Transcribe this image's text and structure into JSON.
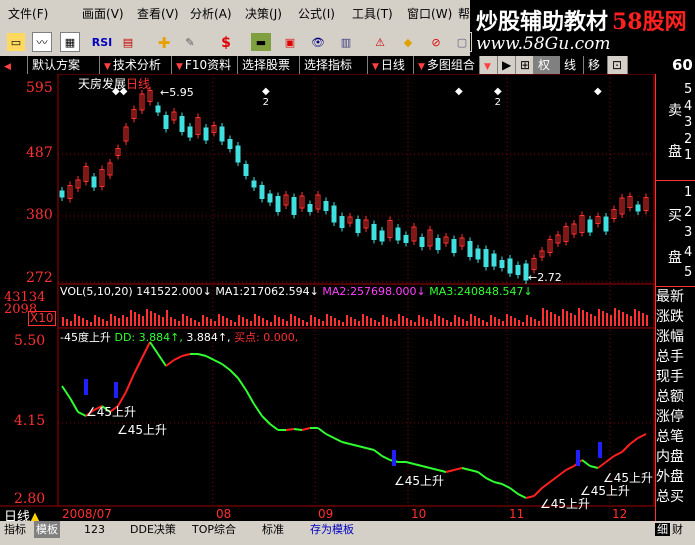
{
  "menu": {
    "items": [
      "文件",
      "画面",
      "查看",
      "分析",
      "决策",
      "公式",
      "工具",
      "窗口",
      "帮"
    ],
    "shortcuts": [
      "(F)",
      "(V)",
      "(V)",
      "(A)",
      "(J)",
      "(I)",
      "(T)",
      "(W)"
    ]
  },
  "logo": {
    "text": "炒股辅助教材",
    "brand": "58股网",
    "url": "www.58Gu.com"
  },
  "toolbar": {
    "rsi_label": "RSI",
    "dollar_label": "$"
  },
  "tabs": {
    "items": [
      "默认方案",
      "技术分析",
      "F10资料",
      "选择股票",
      "选择指标",
      "日线",
      "多图组合"
    ],
    "right_icons": [
      "▶",
      "⊞",
      "权",
      "线",
      "移",
      "⊡"
    ],
    "corner_value": "60"
  },
  "stock": {
    "name": "天房发展",
    "period": "日线",
    "high_marker": "5.95",
    "low_marker": "2.72",
    "info_marker": "2"
  },
  "price_axis": {
    "labels": [
      "595",
      "487",
      "380",
      "272"
    ]
  },
  "volume": {
    "formula": "VOL(5,10,20)",
    "vol": "141522.000",
    "ma1_label": "MA1:",
    "ma1": "217062.594",
    "ma2_label": "MA2:",
    "ma2": "257698.000",
    "ma3_label": "MA3:",
    "ma3": "240848.547",
    "axis_top": "43134",
    "axis_mid": "2098",
    "axis_unit": "X10"
  },
  "indicator": {
    "name": "-45度上升",
    "dd_label": "DD:",
    "dd_value": "3.884",
    "dd_value2": "3.884",
    "buy_label": "买点:",
    "buy_value": "0.000",
    "signal_label": "∠45上升",
    "axis_top": "5.50",
    "axis_mid": "4.15",
    "axis_bottom": "2.80"
  },
  "dates": {
    "labels": [
      "2008/07",
      "08",
      "09",
      "10",
      "11",
      "12"
    ],
    "period": "日线"
  },
  "side_panel": {
    "sell": [
      "卖",
      "盘"
    ],
    "buy": [
      "买",
      "盘"
    ],
    "sell_levels": [
      "1",
      "2",
      "3",
      "4",
      "5"
    ],
    "buy_levels": [
      "1",
      "2",
      "3",
      "4",
      "5"
    ],
    "stats": [
      "最新",
      "涨跌",
      "涨幅",
      "总手",
      "现手",
      "总额",
      "涨停",
      "总笔",
      "内盘",
      "外盘",
      "总买"
    ]
  },
  "bottom_tabs": {
    "items": [
      "指标",
      "模板",
      "123",
      "DDE决策",
      "TOP综合",
      "标准",
      "存为模板"
    ],
    "right": [
      "细",
      "财"
    ]
  },
  "colors": {
    "up": "#ff3030",
    "down": "#40e0e0",
    "line_up": "#ff2020",
    "line_down": "#30ff30",
    "signal": "#2020ff",
    "ma1": "#ffffff",
    "ma2": "#ff40ff",
    "ma3": "#30ff30"
  }
}
